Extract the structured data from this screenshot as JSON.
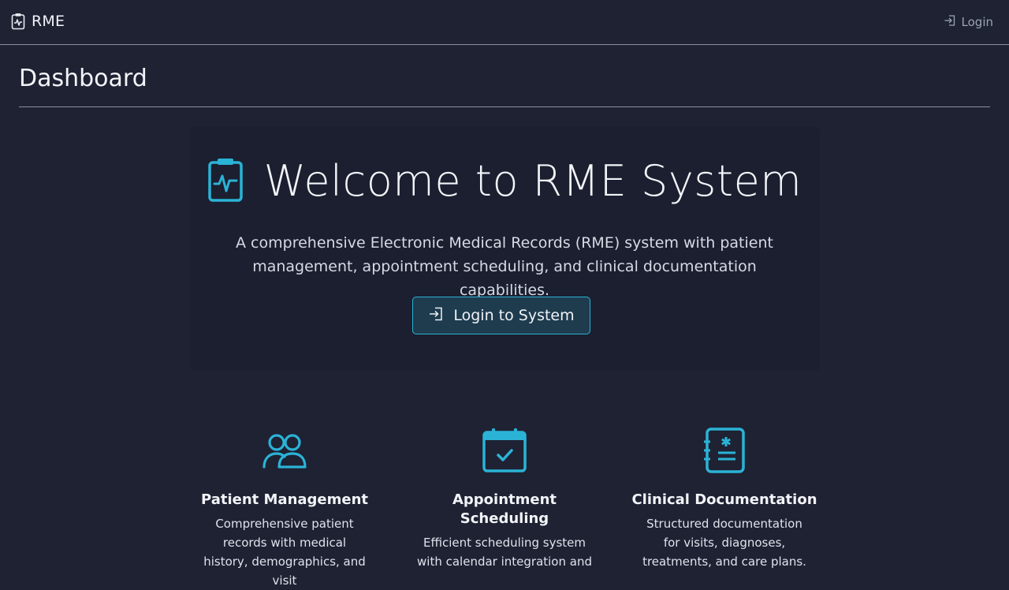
{
  "app": {
    "brand_name": "RME",
    "brand_icon": "clipboard-pulse-icon"
  },
  "nav": {
    "login_label": "Login",
    "login_icon": "login-arrow-icon"
  },
  "page": {
    "title": "Dashboard"
  },
  "hero": {
    "icon": "clipboard-pulse-icon",
    "title": "Welcome to RME System",
    "description": "A comprehensive Electronic Medical Records (RME) system with patient management, appointment scheduling, and clinical documentation capabilities.",
    "button_label": "Login to System",
    "button_icon": "login-arrow-icon"
  },
  "features": [
    {
      "icon": "people-icon",
      "title": "Patient Management",
      "description": "Comprehensive patient records with medical history, demographics, and visit"
    },
    {
      "icon": "calendar-check-icon",
      "title": "Appointment Scheduling",
      "description": "Efficient scheduling system with calendar integration and"
    },
    {
      "icon": "medical-document-icon",
      "title": "Clinical Documentation",
      "description": "Structured documentation for visits, diagnoses, treatments, and care plans."
    }
  ],
  "colors": {
    "background": "#1e2233",
    "accent": "#2bb3d6",
    "text": "#f2f4f8"
  }
}
